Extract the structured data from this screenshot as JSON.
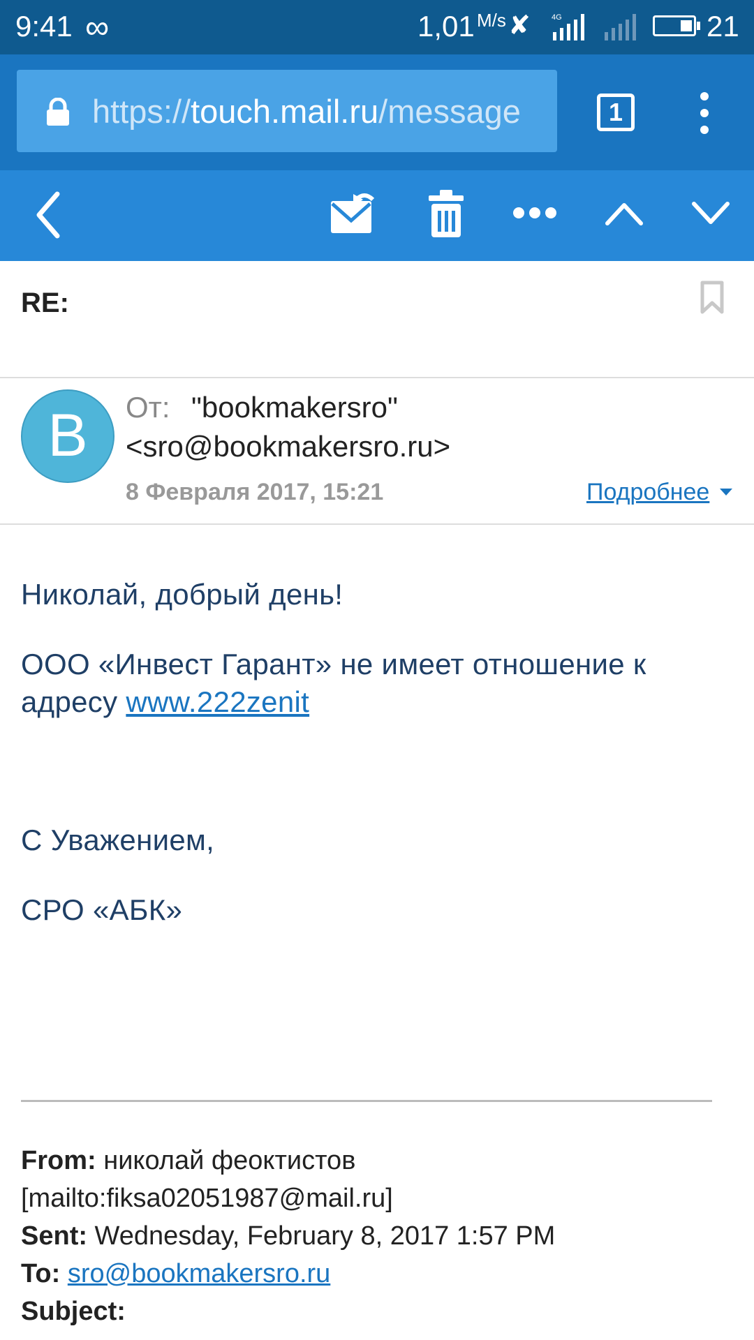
{
  "status_bar": {
    "time": "9:41",
    "infinity_glyph": "∞",
    "net_speed": "1,01",
    "net_speed_unit": "M/s",
    "network_type": "4G",
    "battery_level": "21"
  },
  "browser": {
    "url_scheme": "https://",
    "url_host": "touch.mail.ru",
    "url_path": "/message",
    "tab_count": "1"
  },
  "message": {
    "subject": "RE:",
    "avatar_letter": "B",
    "from_label": "От:",
    "from_name": "\"bookmakersro\"",
    "from_email": "<sro@bookmakersro.ru>",
    "date": "8 Февраля 2017, 15:21",
    "details_label": "Подробнее",
    "body": {
      "greeting": "Николай, добрый день!",
      "line1": "ООО «Инвест Гарант» не имеет отношение к",
      "line2_prefix": "адресу ",
      "link": "www.222zenit",
      "regards": "С Уважением,",
      "signature": "СРО «АБК»"
    },
    "quoted": {
      "from_label": "From:",
      "from_value": " николай феоктистов",
      "mailto": "[mailto:fiksa02051987@mail.ru]",
      "sent_label": "Sent:",
      "sent_value": " Wednesday, February 8, 2017 1:57 PM",
      "to_label": "To:",
      "to_value": "sro@bookmakersro.ru",
      "subject_label": "Subject:"
    }
  },
  "colors": {
    "status_bar": "#0f5a8f",
    "url_bar": "#1a75c0",
    "toolbar": "#2788d8",
    "avatar": "#4fb5d9",
    "body_text": "#1f3f66",
    "link": "#1a75c0"
  },
  "icons": [
    "lock-icon",
    "tabs-icon",
    "overflow-menu-icon",
    "back-icon",
    "move-to-folder-icon",
    "trash-icon",
    "more-icon",
    "prev-message-icon",
    "next-message-icon",
    "bookmark-icon"
  ]
}
